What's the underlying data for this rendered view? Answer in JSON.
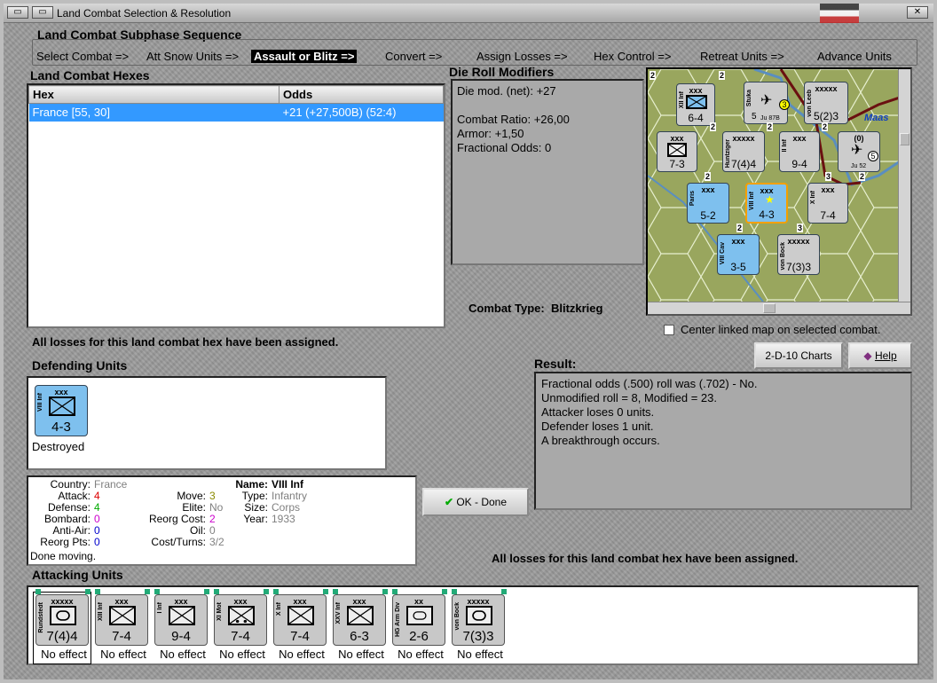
{
  "window": {
    "title": "Land Combat Selection & Resolution"
  },
  "subphase": {
    "title": "Land Combat Subphase Sequence",
    "steps": [
      "Select Combat =>",
      "Att Snow Units =>",
      "Assault or Blitz =>",
      "Convert =>",
      "Assign Losses =>",
      "Hex Control =>",
      "Retreat Units =>",
      "Advance Units"
    ],
    "selected_index": 2
  },
  "hexes": {
    "title": "Land Combat Hexes",
    "columns": [
      "Hex",
      "Odds"
    ],
    "rows": [
      {
        "hex": "France [55, 30]",
        "odds": "+21 (+27,500B) (52:4)"
      }
    ]
  },
  "modifiers": {
    "title": "Die Roll Modifiers",
    "lines": [
      "Die mod. (net): +27",
      "",
      "Combat Ratio: +26,00",
      "Armor: +1,50",
      "Fractional Odds: 0"
    ]
  },
  "combat_type": {
    "label": "Combat Type:",
    "value": "Blitzkrieg"
  },
  "center_map": {
    "label": "Center linked map on selected combat.",
    "checked": false
  },
  "losses_note_top": "All losses for this land combat hex have been assigned.",
  "losses_note_bottom": "All losses for this land combat hex have been assigned.",
  "buttons": {
    "charts": "2-D-10 Charts",
    "help": "Help",
    "ok": "OK - Done"
  },
  "defending": {
    "title": "Defending Units",
    "units": [
      {
        "size": "xxx",
        "name": "VIII Inf",
        "strength": "4-3",
        "status": "Destroyed"
      }
    ]
  },
  "result": {
    "title": "Result:",
    "lines": [
      "Fractional odds (.500) roll was (.702)  - No.",
      "Unmodified roll = 8, Modified = 23.",
      "Attacker loses 0 units.",
      "Defender loses 1 unit.",
      "A breakthrough occurs."
    ]
  },
  "details": {
    "country_label": "Country:",
    "country": "France",
    "attack_label": "Attack:",
    "attack": "4",
    "defense_label": "Defense:",
    "defense": "4",
    "bombard_label": "Bombard:",
    "bombard": "0",
    "antiair_label": "Anti-Air:",
    "antiair": "0",
    "reorg_label": "Reorg Pts:",
    "reorg": "0",
    "move_label": "Move:",
    "move": "3",
    "elite_label": "Elite:",
    "elite": "No",
    "reorgcost_label": "Reorg Cost:",
    "reorgcost": "2",
    "oil_label": "Oil:",
    "oil": "0",
    "costturns_label": "Cost/Turns:",
    "costturns": "3/2",
    "name_label": "Name:",
    "name": "VIII Inf",
    "type_label": "Type:",
    "type": "Infantry",
    "size_label": "Size:",
    "size": "Corps",
    "year_label": "Year:",
    "year": "1933",
    "status": "Done moving."
  },
  "attacking": {
    "title": "Attacking Units",
    "units": [
      {
        "size": "xxxxx",
        "name": "Rundstedt",
        "strength": "7(4)4",
        "status": "No effect",
        "kind": "hq"
      },
      {
        "size": "xxx",
        "name": "XIII Inf",
        "strength": "7-4",
        "status": "No effect",
        "kind": "inf"
      },
      {
        "size": "xxx",
        "name": "I Inf",
        "strength": "9-4",
        "status": "No effect",
        "kind": "inf"
      },
      {
        "size": "xxx",
        "name": "XI Mot",
        "strength": "7-4",
        "status": "No effect",
        "kind": "mot"
      },
      {
        "size": "xxx",
        "name": "X Inf",
        "strength": "7-4",
        "status": "No effect",
        "kind": "inf"
      },
      {
        "size": "xxx",
        "name": "XXV Inf",
        "strength": "6-3",
        "status": "No effect",
        "kind": "inf"
      },
      {
        "size": "xx",
        "name": "HG Arm Div",
        "strength": "2-6",
        "status": "No effect",
        "kind": "arm"
      },
      {
        "size": "xxxxx",
        "name": "von Bock",
        "strength": "7(3)3",
        "status": "No effect",
        "kind": "hq"
      }
    ]
  },
  "map": {
    "labels": [
      "Maas"
    ],
    "counters": [
      {
        "size": "xxx",
        "name": "XII Inf",
        "strength": "6-4"
      },
      {
        "size": "",
        "name": "Stuka",
        "strength": "5",
        "extra": "Ju 87B"
      },
      {
        "size": "xxxxx",
        "name": "von Leeb",
        "strength": "5(2)3"
      },
      {
        "size": "xxx",
        "name": "",
        "strength": "7-3"
      },
      {
        "size": "xxxxx",
        "name": "Huntziger",
        "strength": "7(4)4"
      },
      {
        "size": "xxx",
        "name": "II Inf",
        "strength": "9-4"
      },
      {
        "size": "(0)",
        "name": "",
        "strength": "5",
        "extra": "Ju 52"
      },
      {
        "size": "xxx",
        "name": "Paris",
        "strength": "5-2"
      },
      {
        "size": "xxx",
        "name": "VIII Inf",
        "strength": "4-3"
      },
      {
        "size": "xxx",
        "name": "X Inf",
        "strength": "7-4"
      },
      {
        "size": "xxx",
        "name": "VIII Cav",
        "strength": "3-5"
      },
      {
        "size": "xxxxx",
        "name": "von Bock",
        "strength": "7(3)3"
      }
    ],
    "stack_digits": [
      "2",
      "2",
      "2",
      "2",
      "2",
      "3",
      "2",
      "3",
      "2",
      "2"
    ],
    "corner_numbers": [
      "3",
      "5"
    ]
  },
  "colors": {
    "french": "#7ec0ee",
    "german": "#c8c8c8",
    "selection": "#3399ff"
  }
}
